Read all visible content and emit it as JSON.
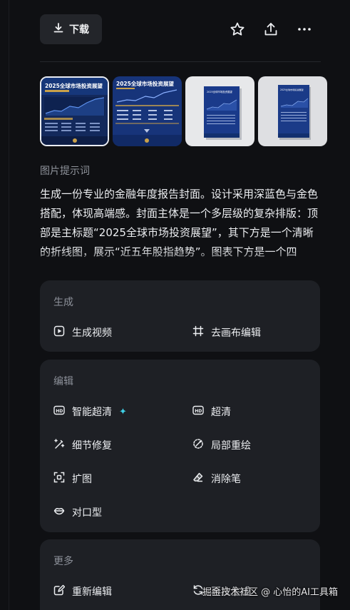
{
  "toolbar": {
    "download_label": "下载",
    "download_icon": "download-icon",
    "favorite_icon": "star-icon",
    "share_icon": "share-icon",
    "more_icon": "more-icon"
  },
  "thumbnails": [
    {
      "title": "2025全球市场投资展望",
      "selected": true
    },
    {
      "title": "2025全球市场投资展望",
      "selected": false
    },
    {
      "title": "2025全球市场投资展望",
      "selected": false
    },
    {
      "title": "2025全球市场投资展望",
      "selected": false
    }
  ],
  "prompt": {
    "label": "图片提示词",
    "text": "生成一份专业的金融年度报告封面。设计采用深蓝色与金色搭配，体现高端感。封面主体是一个多层级的复杂排版：顶部是主标题“2025全球市场投资展望”，其下方是一个清晰的折线图，展示“近五年股指趋势”。图表下方是一个四"
  },
  "sections": {
    "generate": {
      "title": "生成",
      "actions": [
        {
          "label": "生成视频",
          "icon": "play-icon"
        },
        {
          "label": "去画布编辑",
          "icon": "crop-icon"
        }
      ]
    },
    "edit": {
      "title": "编辑",
      "actions": [
        {
          "label": "智能超清",
          "icon": "hd-icon",
          "badge": "sparkle-icon"
        },
        {
          "label": "超清",
          "icon": "hd-icon"
        },
        {
          "label": "细节修复",
          "icon": "magic-wand-icon"
        },
        {
          "label": "局部重绘",
          "icon": "redraw-icon"
        },
        {
          "label": "扩图",
          "icon": "expand-icon"
        },
        {
          "label": "消除笔",
          "icon": "eraser-icon"
        },
        {
          "label": "对口型",
          "icon": "lips-icon"
        }
      ]
    },
    "more": {
      "title": "更多",
      "actions": [
        {
          "label": "重新编辑",
          "icon": "edit-icon"
        },
        {
          "label": "再次生成",
          "icon": "regenerate-icon"
        }
      ]
    }
  },
  "watermark": "掘金技术社区 @ 心怡的AI工具箱",
  "colors": {
    "background": "#0f1013",
    "card": "#1e2025",
    "accent_sparkle": "#3fd0e6",
    "thumb_navy": "#1a3a7a",
    "thumb_gold": "#c9a14a"
  }
}
